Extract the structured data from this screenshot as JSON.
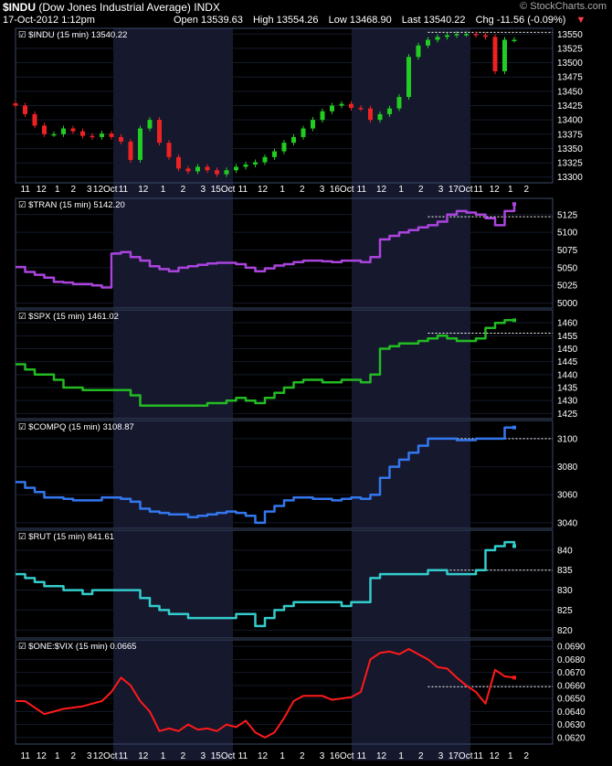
{
  "header": {
    "symbol": "$INDU",
    "name": "(Dow Jones Industrial Average)",
    "exchange": "INDX",
    "date": "17-Oct-2012 1:12pm",
    "credit": "© StockCharts.com",
    "quote": [
      {
        "label": "Open",
        "value": "13539.63"
      },
      {
        "label": "High",
        "value": "13554.26"
      },
      {
        "label": "Low",
        "value": "13468.90"
      },
      {
        "label": "Last",
        "value": "13540.22"
      }
    ],
    "change_label": "Chg",
    "change_value": "-11.56 (-0.09%)",
    "change_arrow": "▼"
  },
  "x_axis": {
    "ticks": [
      "11",
      "12",
      "1",
      "2",
      "3",
      "12Oct",
      "11",
      "12",
      "1",
      "2",
      "3",
      "15Oct",
      "11",
      "12",
      "1",
      "2",
      "3",
      "16Oct",
      "11",
      "12",
      "1",
      "2",
      "3",
      "17Oct",
      "11",
      "12",
      "1",
      "2"
    ]
  },
  "colors": {
    "up_candle": "#22cc22",
    "down_candle": "#ee2222",
    "tran": "#aa44dd",
    "spx": "#22bb22",
    "compq": "#3377ee",
    "rut": "#33cccc",
    "vix_ratio": "#ff1a1a",
    "panel_border": "#3a4a6a",
    "shade": "#16182e",
    "grid": "#141a2a"
  },
  "chart_data": [
    {
      "type": "candlestick",
      "title": "$INDU (15 min) 13540.22",
      "ylim": [
        13290,
        13560
      ],
      "yticks": [
        13300,
        13325,
        13350,
        13375,
        13400,
        13425,
        13450,
        13475,
        13500,
        13525,
        13550
      ],
      "reference": 13553,
      "x": [
        0,
        2,
        4,
        6,
        8,
        10,
        12,
        14,
        16,
        18,
        20,
        22,
        24,
        26,
        28,
        30,
        32,
        34,
        36,
        38,
        40,
        42,
        44,
        46,
        48,
        50,
        52,
        54,
        56,
        58,
        60,
        62,
        64,
        66,
        68,
        70,
        72,
        74,
        76,
        78,
        80,
        82,
        84,
        86,
        88,
        90,
        92,
        94,
        96,
        98,
        100,
        102,
        104
      ],
      "values": [
        13425,
        13410,
        13390,
        13375,
        13375,
        13385,
        13380,
        13372,
        13370,
        13376,
        13370,
        13362,
        13330,
        13385,
        13400,
        13360,
        13335,
        13315,
        13310,
        13318,
        13312,
        13305,
        13312,
        13318,
        13322,
        13326,
        13335,
        13345,
        13360,
        13370,
        13385,
        13400,
        13415,
        13425,
        13428,
        13421,
        13420,
        13400,
        13410,
        13420,
        13440,
        13510,
        13530,
        13540,
        13545,
        13548,
        13550,
        13550,
        13548,
        13545,
        13485,
        13540,
        13540
      ]
    },
    {
      "type": "line",
      "title": "$TRAN (15 min) 5142.20",
      "ylim": [
        4993,
        5148
      ],
      "yticks": [
        5000,
        5025,
        5050,
        5075,
        5100,
        5125
      ],
      "reference": 5122,
      "x": [
        0,
        2,
        4,
        6,
        8,
        10,
        12,
        14,
        16,
        18,
        20,
        22,
        24,
        26,
        28,
        30,
        32,
        34,
        36,
        38,
        40,
        42,
        44,
        46,
        48,
        50,
        52,
        54,
        56,
        58,
        60,
        62,
        64,
        66,
        68,
        70,
        72,
        74,
        76,
        78,
        80,
        82,
        84,
        86,
        88,
        90,
        92,
        94,
        96,
        98,
        100,
        102,
        104
      ],
      "values": [
        5051,
        5044,
        5040,
        5036,
        5030,
        5029,
        5027,
        5027,
        5025,
        5022,
        5070,
        5072,
        5065,
        5060,
        5052,
        5048,
        5045,
        5050,
        5052,
        5054,
        5056,
        5057,
        5057,
        5055,
        5050,
        5045,
        5049,
        5053,
        5055,
        5058,
        5060,
        5060,
        5059,
        5058,
        5060,
        5060,
        5058,
        5065,
        5090,
        5095,
        5100,
        5103,
        5107,
        5110,
        5115,
        5125,
        5130,
        5128,
        5125,
        5120,
        5110,
        5130,
        5140
      ]
    },
    {
      "type": "line",
      "title": "$SPX (15 min) 1461.02",
      "ylim": [
        1423,
        1465
      ],
      "yticks": [
        1425,
        1430,
        1435,
        1440,
        1445,
        1450,
        1455,
        1460
      ],
      "reference": 1456,
      "x": [
        0,
        2,
        4,
        6,
        8,
        10,
        12,
        14,
        16,
        18,
        20,
        22,
        24,
        26,
        28,
        30,
        32,
        34,
        36,
        38,
        40,
        42,
        44,
        46,
        48,
        50,
        52,
        54,
        56,
        58,
        60,
        62,
        64,
        66,
        68,
        70,
        72,
        74,
        76,
        78,
        80,
        82,
        84,
        86,
        88,
        90,
        92,
        94,
        96,
        98,
        100,
        102,
        104
      ],
      "values": [
        1444,
        1442,
        1440,
        1440,
        1438,
        1435,
        1435,
        1434,
        1434,
        1434,
        1434,
        1434,
        1432,
        1428,
        1428,
        1428,
        1428,
        1428,
        1428,
        1428,
        1429,
        1429,
        1430,
        1431,
        1430,
        1429,
        1431,
        1433,
        1435,
        1437,
        1438,
        1438,
        1437,
        1437,
        1438,
        1438,
        1437,
        1440,
        1450,
        1451,
        1452,
        1452,
        1453,
        1454,
        1455,
        1454,
        1453,
        1453,
        1454,
        1458,
        1460,
        1461,
        1461
      ]
    },
    {
      "type": "line",
      "title": "$COMPQ (15 min) 3108.87",
      "ylim": [
        3036,
        3113
      ],
      "yticks": [
        3040,
        3060,
        3080,
        3100
      ],
      "reference": 3100,
      "x": [
        0,
        2,
        4,
        6,
        8,
        10,
        12,
        14,
        16,
        18,
        20,
        22,
        24,
        26,
        28,
        30,
        32,
        34,
        36,
        38,
        40,
        42,
        44,
        46,
        48,
        50,
        52,
        54,
        56,
        58,
        60,
        62,
        64,
        66,
        68,
        70,
        72,
        74,
        76,
        78,
        80,
        82,
        84,
        86,
        88,
        90,
        92,
        94,
        96,
        98,
        100,
        102,
        104
      ],
      "values": [
        3069,
        3065,
        3062,
        3058,
        3058,
        3057,
        3056,
        3056,
        3056,
        3058,
        3058,
        3057,
        3055,
        3050,
        3048,
        3047,
        3046,
        3046,
        3044,
        3045,
        3046,
        3047,
        3048,
        3047,
        3045,
        3040,
        3048,
        3052,
        3056,
        3058,
        3058,
        3057,
        3057,
        3056,
        3057,
        3058,
        3057,
        3060,
        3072,
        3080,
        3085,
        3090,
        3095,
        3100,
        3100,
        3100,
        3099,
        3099,
        3100,
        3100,
        3100,
        3108,
        3108
      ]
    },
    {
      "type": "line",
      "title": "$RUT (15 min) 841.61",
      "ylim": [
        818,
        845
      ],
      "yticks": [
        820,
        825,
        830,
        835,
        840
      ],
      "reference": 835,
      "x": [
        0,
        2,
        4,
        6,
        8,
        10,
        12,
        14,
        16,
        18,
        20,
        22,
        24,
        26,
        28,
        30,
        32,
        34,
        36,
        38,
        40,
        42,
        44,
        46,
        48,
        50,
        52,
        54,
        56,
        58,
        60,
        62,
        64,
        66,
        68,
        70,
        72,
        74,
        76,
        78,
        80,
        82,
        84,
        86,
        88,
        90,
        92,
        94,
        96,
        98,
        100,
        102,
        104
      ],
      "values": [
        834,
        833,
        832,
        831,
        831,
        830,
        830,
        829,
        830,
        830,
        830,
        830,
        830,
        828,
        826,
        825,
        824,
        824,
        823,
        823,
        823,
        823,
        823,
        824,
        824,
        821,
        823,
        825,
        826,
        827,
        827,
        827,
        827,
        827,
        826,
        827,
        827,
        833,
        834,
        834,
        834,
        834,
        834,
        835,
        835,
        834,
        834,
        834,
        835,
        840,
        841,
        842,
        841
      ]
    },
    {
      "type": "line",
      "title": "$ONE:$VIX (15 min) 0.0665",
      "ylim": [
        0.0615,
        0.0695
      ],
      "yticks": [
        0.062,
        0.063,
        0.064,
        0.065,
        0.066,
        0.067,
        0.068,
        0.069
      ],
      "reference": 0.0659,
      "x": [
        0,
        2,
        4,
        6,
        8,
        10,
        12,
        14,
        16,
        18,
        20,
        22,
        24,
        26,
        28,
        30,
        32,
        34,
        36,
        38,
        40,
        42,
        44,
        46,
        48,
        50,
        52,
        54,
        56,
        58,
        60,
        62,
        64,
        66,
        68,
        70,
        72,
        74,
        76,
        78,
        80,
        82,
        84,
        86,
        88,
        90,
        92,
        94,
        96,
        98,
        100,
        102,
        104
      ],
      "values": [
        0.0648,
        0.0648,
        0.0643,
        0.0638,
        0.064,
        0.0642,
        0.0643,
        0.0644,
        0.0646,
        0.0648,
        0.0655,
        0.0666,
        0.066,
        0.0648,
        0.064,
        0.0625,
        0.0627,
        0.0625,
        0.063,
        0.0626,
        0.0627,
        0.0625,
        0.063,
        0.0628,
        0.0633,
        0.0624,
        0.062,
        0.0624,
        0.0635,
        0.0648,
        0.0652,
        0.0652,
        0.0652,
        0.0649,
        0.065,
        0.0651,
        0.0655,
        0.068,
        0.0685,
        0.0686,
        0.0684,
        0.0688,
        0.0684,
        0.068,
        0.0674,
        0.0673,
        0.0666,
        0.066,
        0.0655,
        0.0646,
        0.0672,
        0.0667,
        0.0666
      ]
    }
  ]
}
